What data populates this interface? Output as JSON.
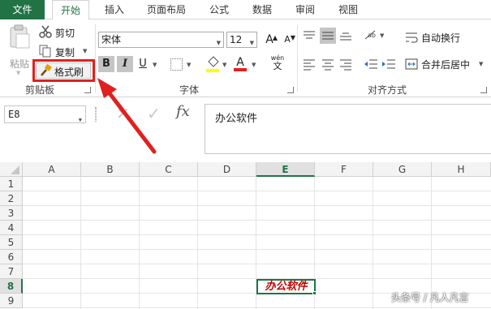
{
  "tabs": [
    {
      "label": "文件",
      "kind": "file"
    },
    {
      "label": "开始",
      "kind": "active"
    },
    {
      "label": "插入",
      "kind": ""
    },
    {
      "label": "页面布局",
      "kind": ""
    },
    {
      "label": "公式",
      "kind": ""
    },
    {
      "label": "数据",
      "kind": ""
    },
    {
      "label": "审阅",
      "kind": ""
    },
    {
      "label": "视图",
      "kind": ""
    }
  ],
  "clipboard": {
    "paste": "粘贴",
    "cut": "剪切",
    "copy": "复制",
    "format_painter": "格式刷",
    "group_label": "剪贴板"
  },
  "font": {
    "name": "宋体",
    "size": "12",
    "bold": "B",
    "italic": "I",
    "underline": "U",
    "grow": "A",
    "shrink": "A",
    "font_color_letter": "A",
    "wen_top": "wén",
    "wen_bottom": "文",
    "group_label": "字体"
  },
  "alignment": {
    "wrap_text": "自动换行",
    "merge_center": "合并后居中",
    "group_label": "对齐方式"
  },
  "formula_bar": {
    "name_box": "E8",
    "fx": "fx",
    "content": "办公软件"
  },
  "columns": [
    "A",
    "B",
    "C",
    "D",
    "E",
    "F",
    "G",
    "H"
  ],
  "rows": [
    "1",
    "2",
    "3",
    "4",
    "5",
    "6",
    "7",
    "8",
    "9"
  ],
  "selected": {
    "column": "E",
    "row": "8",
    "value": "办公软件"
  },
  "watermark": "头条号 / 凡人凡言",
  "colors": {
    "accent": "#217346",
    "annotation": "#e02020",
    "cell_text": "#c00000"
  }
}
